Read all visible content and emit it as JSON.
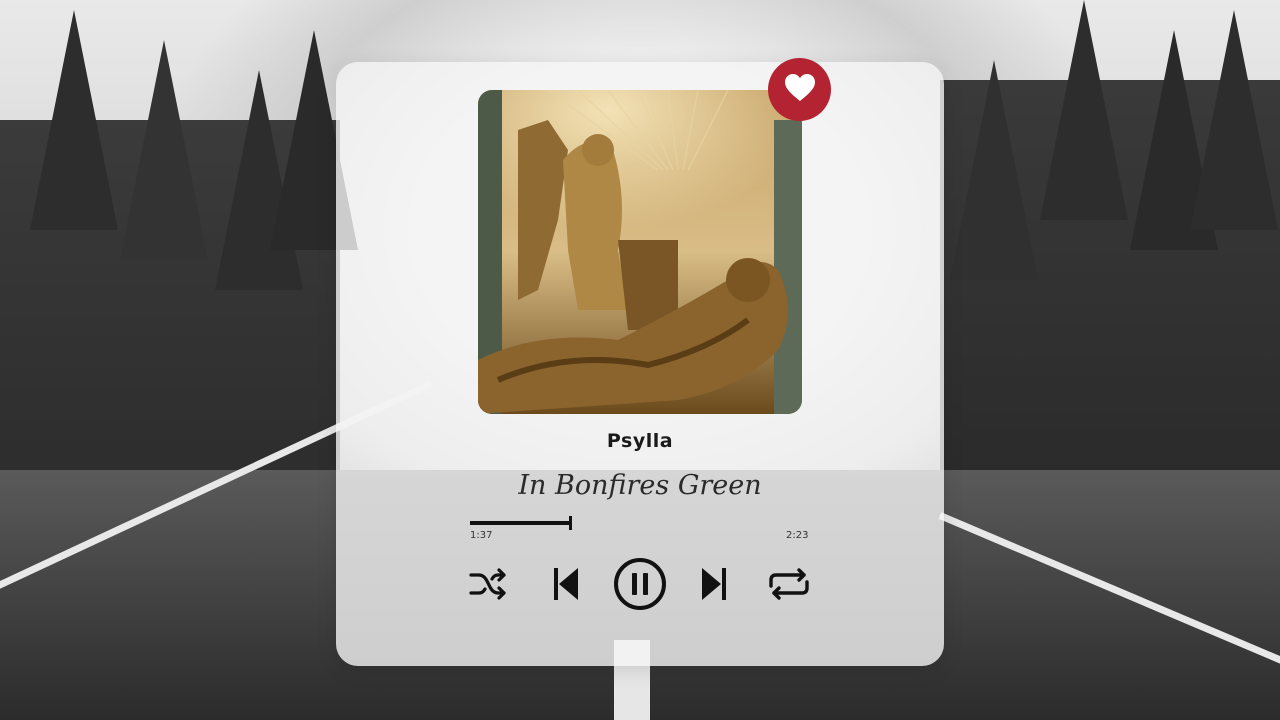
{
  "player": {
    "artist": "Psylla",
    "track_title": "In Bonfires Green",
    "time_elapsed": "1:37",
    "time_total": "2:23",
    "progress_fraction": 0.29,
    "favorited": true,
    "is_playing": true
  },
  "icons": {
    "favorite": "heart-icon",
    "shuffle": "shuffle-icon",
    "previous": "skip-previous-icon",
    "pause": "pause-icon",
    "next": "skip-next-icon",
    "repeat": "repeat-icon"
  },
  "colors": {
    "favorite_badge": "#b42332",
    "controls": "#111111",
    "card": "#f5f5f5"
  }
}
